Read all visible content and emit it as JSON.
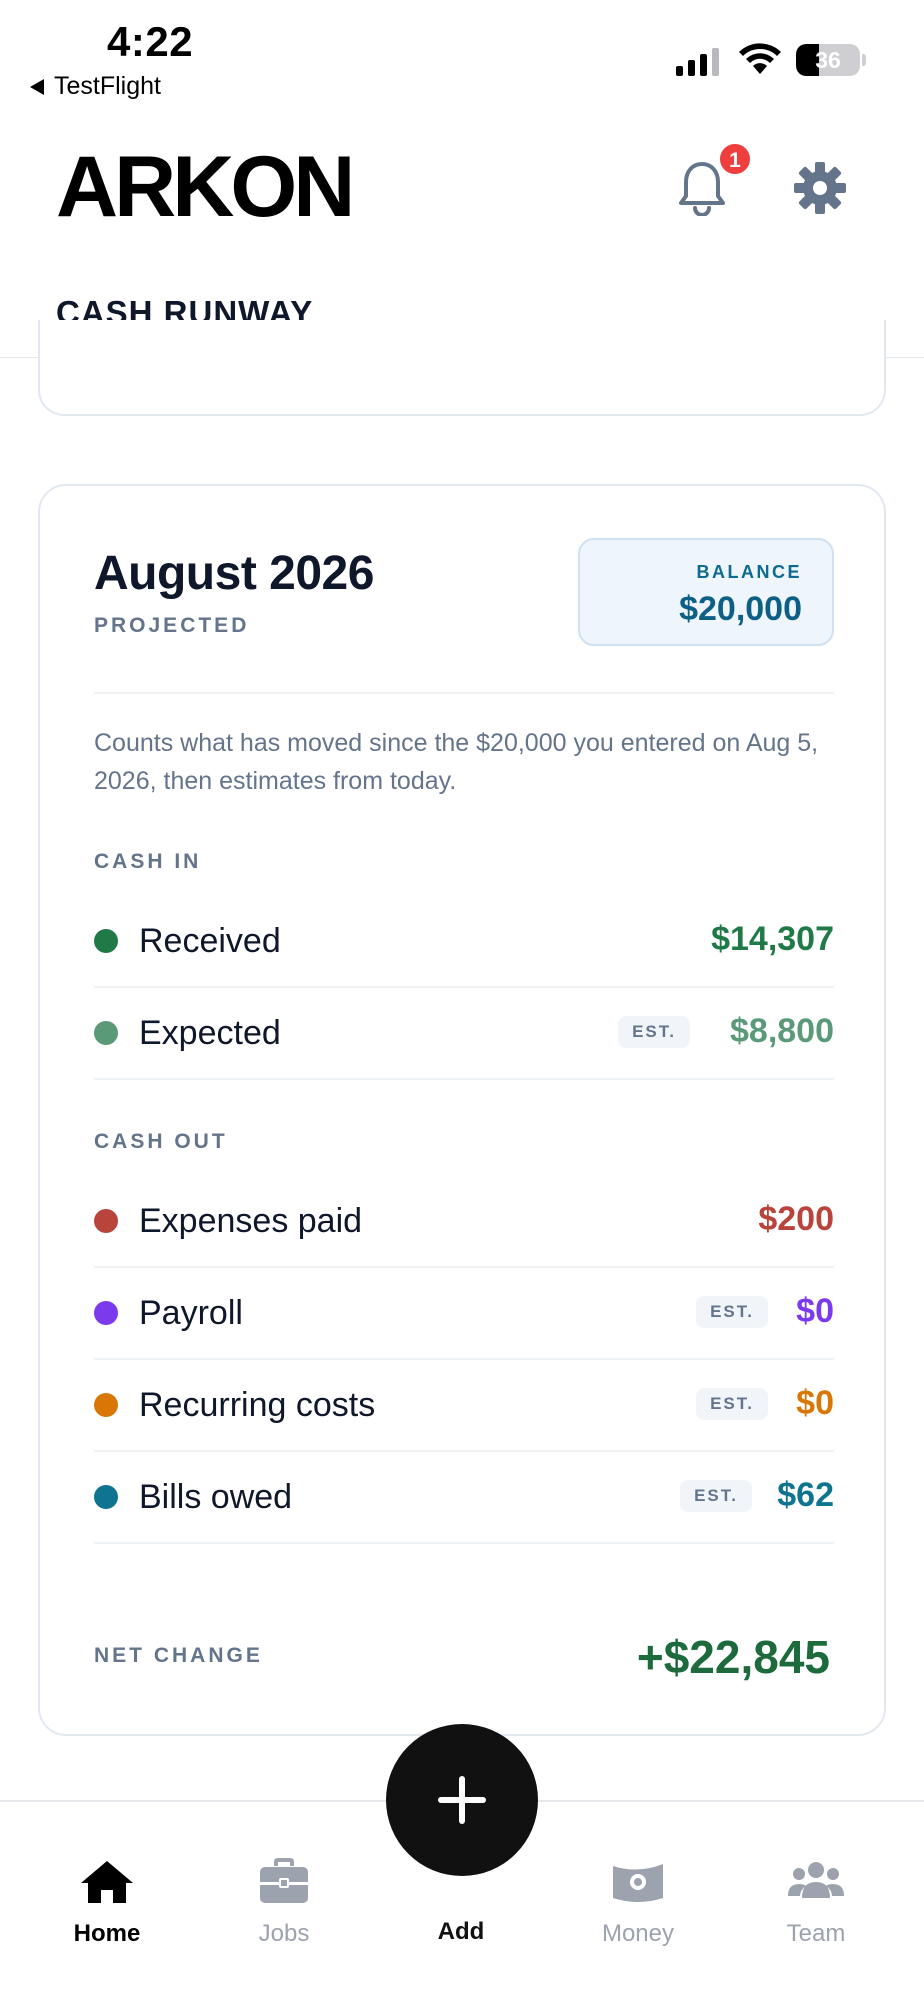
{
  "status_bar": {
    "time": "4:22",
    "back_app": "TestFlight",
    "battery_percent": "36"
  },
  "header": {
    "logo": "ARKON",
    "notification_count": "1"
  },
  "tabs": [
    {
      "label": "CASH RUNWAY",
      "active": true
    }
  ],
  "summary": {
    "month": "August 2026",
    "status": "PROJECTED",
    "balance_label": "BALANCE",
    "balance_value": "$20,000",
    "note": "Counts what has moved since the $20,000 you entered on Aug 5, 2026, then estimates from today.",
    "cash_in": {
      "label": "CASH IN",
      "rows": [
        {
          "label": "Received",
          "value": "$14,307",
          "estimated": false,
          "color": "#1f7a48"
        },
        {
          "label": "Expected",
          "value": "$8,800",
          "estimated": true,
          "est_label": "EST.",
          "color": "#5a9a78"
        }
      ]
    },
    "cash_out": {
      "label": "CASH OUT",
      "rows": [
        {
          "label": "Expenses paid",
          "value": "$200",
          "estimated": false,
          "color": "#b8443c"
        },
        {
          "label": "Payroll",
          "value": "$0",
          "estimated": true,
          "est_label": "EST.",
          "color": "#7c3aed"
        },
        {
          "label": "Recurring costs",
          "value": "$0",
          "estimated": true,
          "est_label": "EST.",
          "color": "#d97706"
        },
        {
          "label": "Bills owed",
          "value": "$62",
          "estimated": true,
          "est_label": "EST.",
          "color": "#0e7490"
        }
      ]
    },
    "net_change_label": "NET CHANGE",
    "net_change_value": "+$22,845"
  },
  "bottom_nav": {
    "items": [
      {
        "label": "Home",
        "icon": "home-icon",
        "active": true
      },
      {
        "label": "Jobs",
        "icon": "briefcase-icon",
        "active": false
      },
      {
        "label": "Add",
        "icon": "plus-icon",
        "active": false
      },
      {
        "label": "Money",
        "icon": "money-icon",
        "active": false
      },
      {
        "label": "Team",
        "icon": "team-icon",
        "active": false
      }
    ]
  }
}
